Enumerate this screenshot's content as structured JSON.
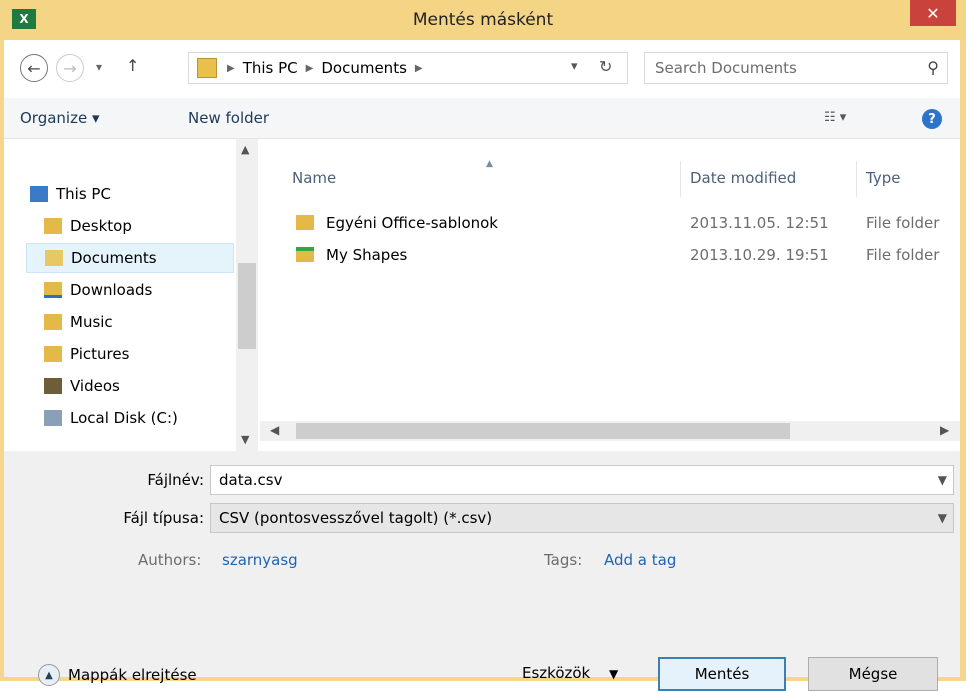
{
  "window": {
    "title": "Mentés másként",
    "app_icon": "X",
    "close": "✕"
  },
  "nav": {
    "breadcrumb": [
      "This PC",
      "Documents"
    ],
    "search_placeholder": "Search Documents"
  },
  "toolbar": {
    "organize": "Organize ▾",
    "new_folder": "New folder"
  },
  "sidebar": {
    "items": [
      {
        "label": "This PC",
        "icon": "computer-icon"
      },
      {
        "label": "Desktop",
        "icon": "desktop-folder-icon"
      },
      {
        "label": "Documents",
        "icon": "documents-folder-icon",
        "selected": true
      },
      {
        "label": "Downloads",
        "icon": "downloads-folder-icon"
      },
      {
        "label": "Music",
        "icon": "music-folder-icon"
      },
      {
        "label": "Pictures",
        "icon": "pictures-folder-icon"
      },
      {
        "label": "Videos",
        "icon": "videos-folder-icon"
      },
      {
        "label": "Local Disk (C:)",
        "icon": "drive-icon"
      }
    ]
  },
  "columns": {
    "name": "Name",
    "date": "Date modified",
    "type": "Type"
  },
  "files": [
    {
      "name": "Egyéni Office-sablonok",
      "date": "2013.11.05. 12:51",
      "type": "File folder",
      "icon": "folder-icon"
    },
    {
      "name": "My Shapes",
      "date": "2013.10.29. 19:51",
      "type": "File folder",
      "icon": "shapes-folder-icon"
    }
  ],
  "form": {
    "filename_label": "Fájlnév:",
    "filename_value": "data.csv",
    "filetype_label": "Fájl típusa:",
    "filetype_value": "CSV (pontosvesszővel tagolt) (*.csv)",
    "authors_label": "Authors:",
    "authors_value": "szarnyasg",
    "tags_label": "Tags:",
    "tags_value": "Add a tag"
  },
  "buttons": {
    "hide_folders": "Mappák elrejtése",
    "tools": "Eszközök",
    "save": "Mentés",
    "cancel": "Mégse"
  },
  "colors": {
    "title_bar": "#f4d485",
    "close": "#c9423b",
    "accent": "#3c7fb1",
    "link": "#1e64b4"
  }
}
